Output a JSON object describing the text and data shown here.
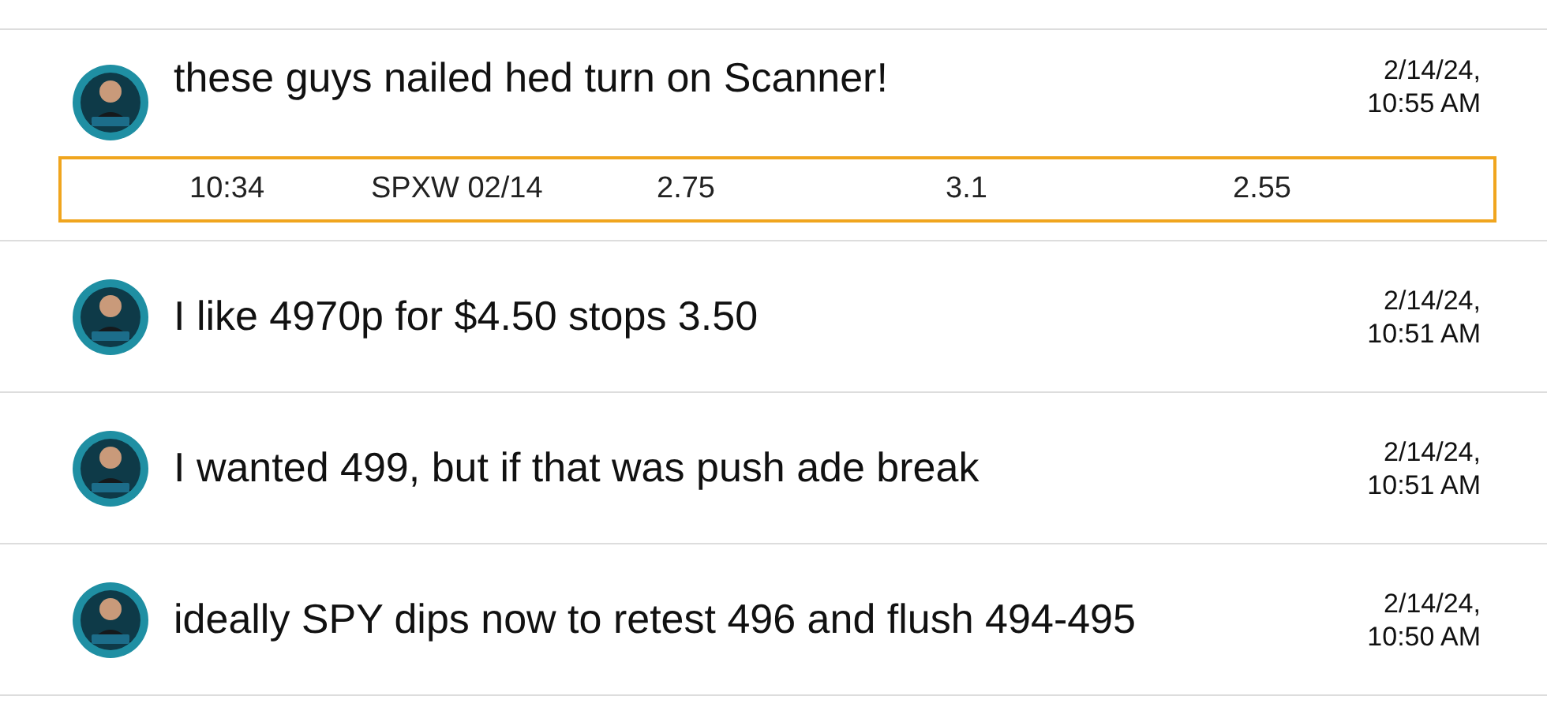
{
  "messages": [
    {
      "text": "these guys nailed hed turn on Scanner!",
      "date": "2/14/24,",
      "time": "10:55 AM",
      "attachment": {
        "kind": "table_row",
        "cells": [
          "10:34",
          "SPXW 02/14",
          "2.75",
          "3.1",
          "2.55"
        ]
      }
    },
    {
      "text": "I like 4970p for $4.50 stops 3.50",
      "date": "2/14/24,",
      "time": "10:51 AM"
    },
    {
      "text": "I wanted 499, but if that was push ade break",
      "date": "2/14/24,",
      "time": "10:51 AM"
    },
    {
      "text": "ideally SPY dips now to retest 496 and flush 494-495",
      "date": "2/14/24,",
      "time": "10:50 AM"
    }
  ]
}
